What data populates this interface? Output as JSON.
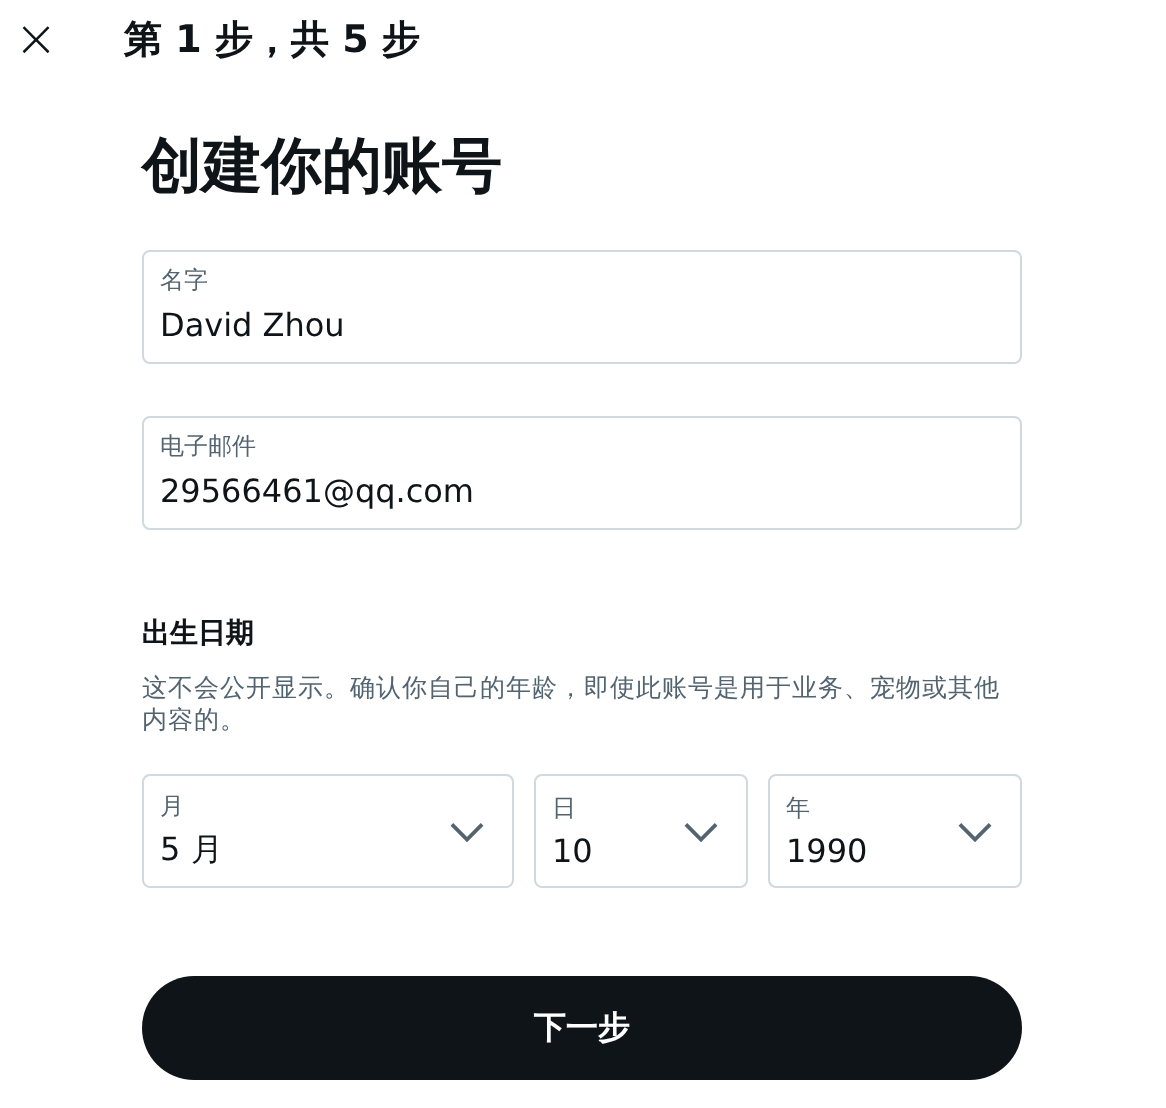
{
  "header": {
    "close": "×",
    "step": "第 1 步，共 5 步"
  },
  "heading": "创建你的账号",
  "fields": [
    {
      "label": "名字",
      "value": "David Zhou"
    },
    {
      "label": "电子邮件",
      "value": "29566461@qq.com"
    }
  ],
  "birthdate": {
    "title": "出生日期",
    "note": "这不会公开显示。确认你自己的年龄，即使此账号是用于业务、宠物或其他内容的。",
    "selects": [
      {
        "label": "月",
        "value": "5 月",
        "kind": "month"
      },
      {
        "label": "日",
        "value": "10",
        "kind": "day"
      },
      {
        "label": "年",
        "value": "1990",
        "kind": "year"
      }
    ]
  },
  "next_button": "下一步"
}
